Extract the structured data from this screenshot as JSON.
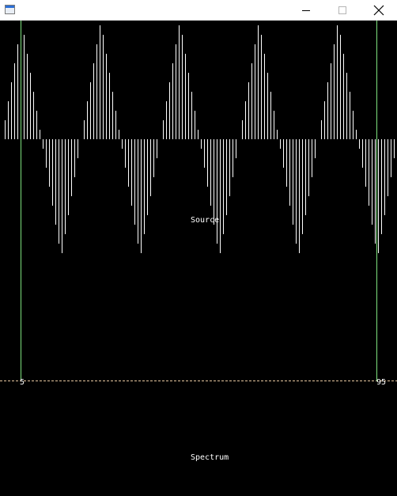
{
  "window": {
    "title": "",
    "icons": {
      "app": "app-icon",
      "minimize": "minimize-icon",
      "maximize": "maximize-icon",
      "close": "close-icon"
    }
  },
  "plot": {
    "source_label": "Source",
    "spectrum_label": "Spectrum",
    "marker_left_label": "5",
    "marker_right_label": "95",
    "colors": {
      "background": "#000000",
      "bars": "#ffffff",
      "markers": "#7ee37e",
      "divider": "#e8c8a0"
    }
  }
}
